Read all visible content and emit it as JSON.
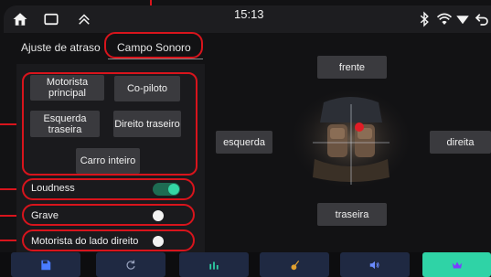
{
  "status_bar": {
    "time": "15:13",
    "icons": [
      "home-icon",
      "recent-apps-icon",
      "collapse-up-icon",
      "bluetooth-icon",
      "wifi-icon",
      "signal-icon",
      "back-icon"
    ]
  },
  "tabs": [
    {
      "label": "Ajuste de atraso"
    },
    {
      "label": "Campo Sonoro"
    }
  ],
  "seat_buttons": [
    {
      "label": "Motorista principal"
    },
    {
      "label": "Co-piloto"
    },
    {
      "label": "Esquerda traseira"
    },
    {
      "label": "Direito traseiro"
    },
    {
      "label": "Carro inteiro"
    }
  ],
  "settings": [
    {
      "label": "Loudness",
      "on": true
    },
    {
      "label": "Grave",
      "on": false
    },
    {
      "label": "Motorista do lado direito",
      "on": false
    }
  ],
  "sound_field": {
    "front": "frente",
    "rear": "traseira",
    "left": "esquerda",
    "right": "direita"
  },
  "dock": {
    "icons": [
      "save-icon",
      "reset-icon",
      "equalizer-icon",
      "guitar-icon",
      "volume-icon",
      "crown-icon"
    ],
    "active_color": "#2fd3a6",
    "button_color": "#1f2942",
    "annotation_color": "#d8141c"
  }
}
